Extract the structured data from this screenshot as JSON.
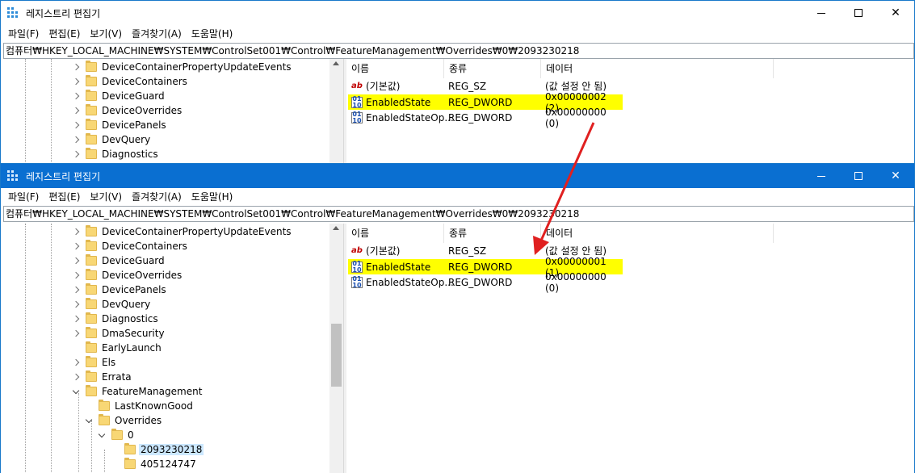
{
  "top_window": {
    "title": "레지스트리 편집기",
    "menu": [
      "파일(F)",
      "편집(E)",
      "보기(V)",
      "즐겨찾기(A)",
      "도움말(H)"
    ],
    "address": "컴퓨터₩HKEY_LOCAL_MACHINE₩SYSTEM₩ControlSet001₩Control₩FeatureManagement₩Overrides₩0₩2093230218",
    "tree": [
      "DeviceContainerPropertyUpdateEvents",
      "DeviceContainers",
      "DeviceGuard",
      "DeviceOverrides",
      "DevicePanels",
      "DevQuery",
      "Diagnostics"
    ],
    "columns": {
      "name": "이름",
      "type": "종류",
      "data": "데이터"
    },
    "values": [
      {
        "name": "(기본값)",
        "type": "REG_SZ",
        "data": "(값 설정 안 됨)",
        "icon": "string-value-icon"
      },
      {
        "name": "EnabledState",
        "type": "REG_DWORD",
        "data": "0x00000002 (2)",
        "icon": "dword-value-icon",
        "highlighted": true
      },
      {
        "name": "EnabledStateOp...",
        "type": "REG_DWORD",
        "data": "0x00000000 (0)",
        "icon": "dword-value-icon"
      }
    ]
  },
  "bottom_window": {
    "title": "레지스트리 편집기",
    "menu": [
      "파일(F)",
      "편집(E)",
      "보기(V)",
      "즐겨찾기(A)",
      "도움말(H)"
    ],
    "address": "컴퓨터₩HKEY_LOCAL_MACHINE₩SYSTEM₩ControlSet001₩Control₩FeatureManagement₩Overrides₩0₩2093230218",
    "tree": [
      "DeviceContainerPropertyUpdateEvents",
      "DeviceContainers",
      "DeviceGuard",
      "DeviceOverrides",
      "DevicePanels",
      "DevQuery",
      "Diagnostics",
      "DmaSecurity",
      "EarlyLaunch",
      "Els",
      "Errata",
      "FeatureManagement",
      "LastKnownGood",
      "Overrides",
      "0",
      "2093230218",
      "405124747"
    ],
    "columns": {
      "name": "이름",
      "type": "종류",
      "data": "데이터"
    },
    "values": [
      {
        "name": "(기본값)",
        "type": "REG_SZ",
        "data": "(값 설정 안 됨)",
        "icon": "string-value-icon"
      },
      {
        "name": "EnabledState",
        "type": "REG_DWORD",
        "data": "0x00000001 (1)",
        "icon": "dword-value-icon",
        "highlighted": true
      },
      {
        "name": "EnabledStateOp...",
        "type": "REG_DWORD",
        "data": "0x00000000 (0)",
        "icon": "dword-value-icon"
      }
    ]
  },
  "colors": {
    "highlight": "#ffff00",
    "arrow": "#e02020",
    "active_titlebar": "#0a6fd1",
    "selection": "#cce8ff"
  },
  "icons": {
    "app": "registry-editor-icon",
    "sz": "ab",
    "dword": "011 110"
  }
}
